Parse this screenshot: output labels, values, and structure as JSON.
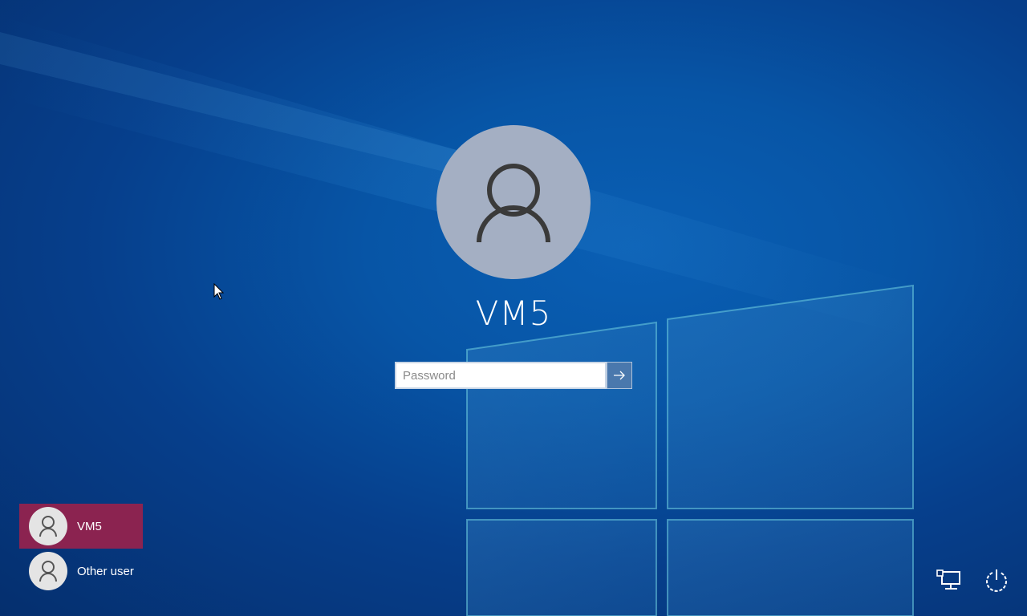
{
  "login": {
    "username": "VM5",
    "password_placeholder": "Password",
    "password_value": ""
  },
  "users": [
    {
      "name": "VM5",
      "selected": true,
      "icon": "user-icon"
    },
    {
      "name": "Other user",
      "selected": false,
      "icon": "user-icon"
    }
  ],
  "corner": {
    "network_icon": "network-icon",
    "power_icon": "power-icon"
  },
  "colors": {
    "background": "#0755a6",
    "selected_user": "#8b2350",
    "submit_button": "#4a78ad",
    "avatar": "#a4afc3"
  }
}
